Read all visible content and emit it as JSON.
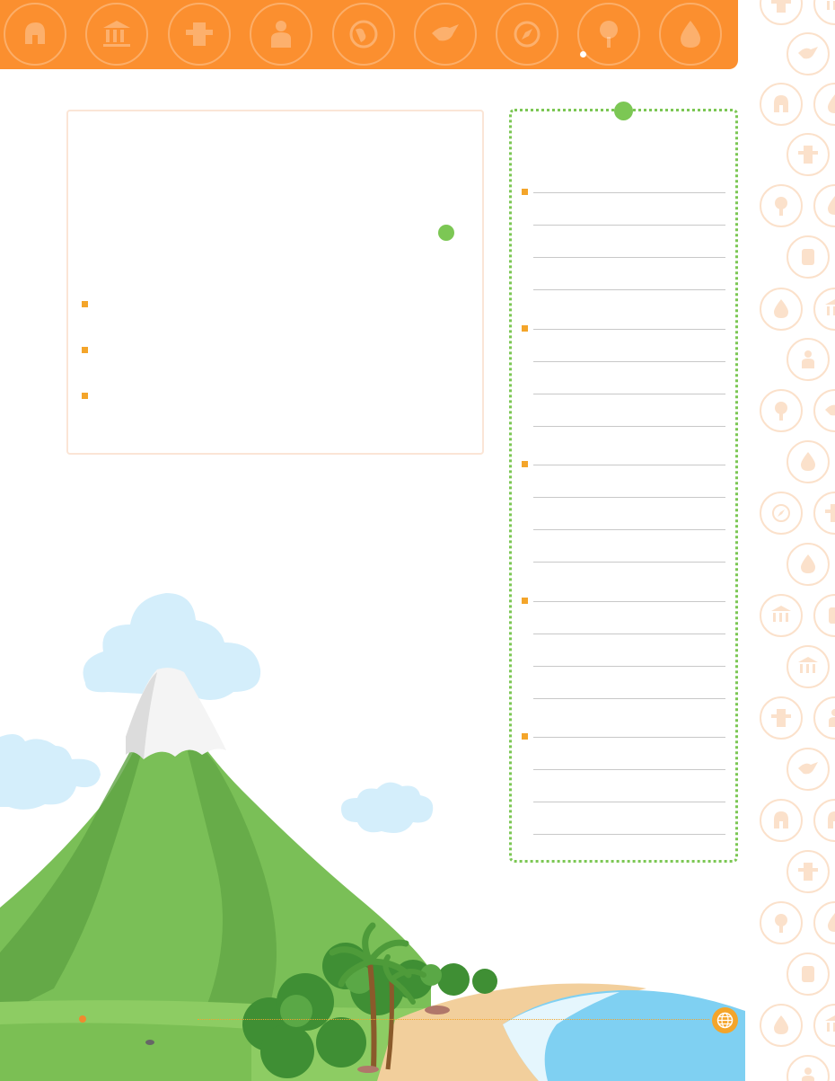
{
  "colors": {
    "banner": "#fb8f2f",
    "accent_green": "#7cc754",
    "bullet": "#f4a52a",
    "box_border": "#fbe5d6",
    "pattern": "#fbe1cb"
  },
  "banner": {
    "icons": [
      "helmet-icon",
      "museum-icon",
      "totem-icon",
      "person-icon",
      "globe-icon",
      "bird-icon",
      "compass-icon",
      "tree-icon",
      "drop-icon"
    ]
  },
  "left_box": {
    "title": "",
    "bullets": [
      "",
      "",
      ""
    ]
  },
  "right_panel": {
    "title": "",
    "sections": [
      {
        "label": "",
        "lines": 4
      },
      {
        "label": "",
        "lines": 4
      },
      {
        "label": "",
        "lines": 4
      },
      {
        "label": "",
        "lines": 4
      },
      {
        "label": "",
        "lines": 4
      }
    ]
  },
  "scene": {
    "description_icons": [
      "volcano-icon",
      "palm-tree-icon",
      "cloud-icon",
      "sea-icon"
    ]
  },
  "footer": {
    "globe": "globe-icon"
  }
}
